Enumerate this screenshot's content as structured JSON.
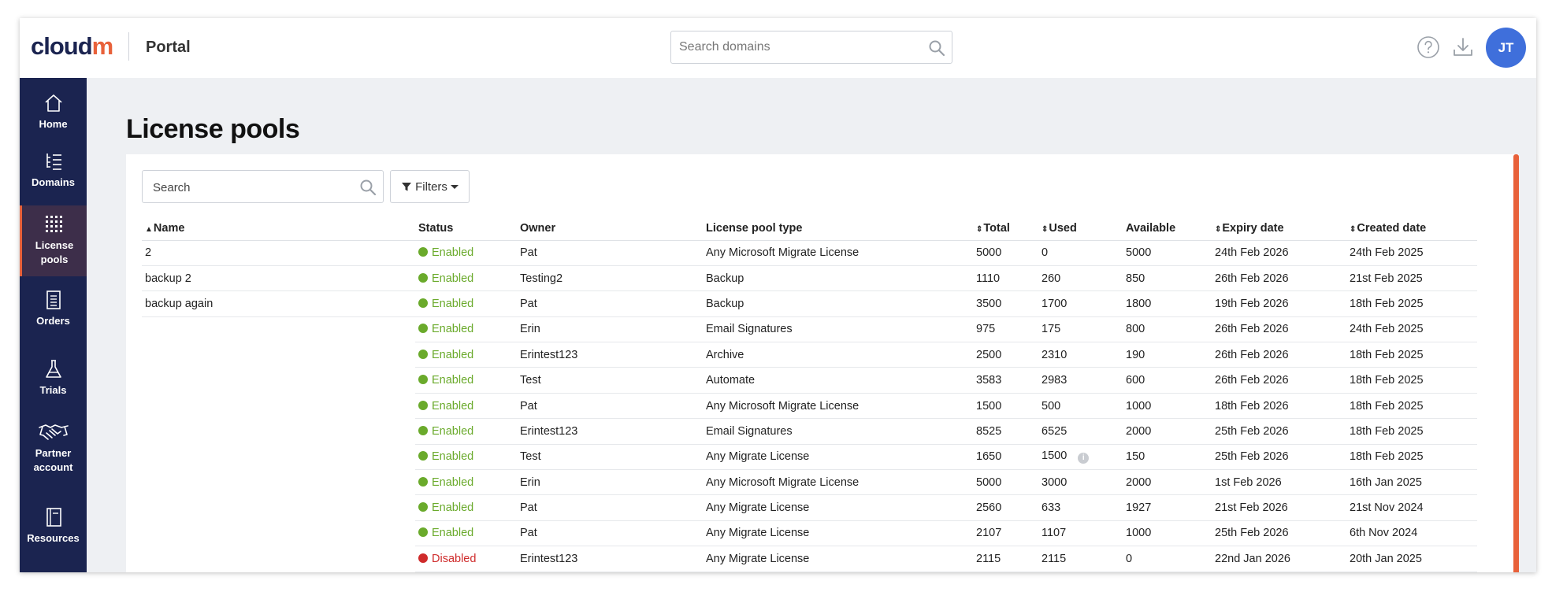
{
  "header": {
    "logo_text_main": "cloud",
    "logo_text_accent": "m",
    "app_name": "Portal",
    "search_placeholder": "Search domains",
    "avatar_initials": "JT"
  },
  "sidebar": {
    "items": [
      {
        "label": "Home",
        "icon": "home-icon"
      },
      {
        "label": "Domains",
        "icon": "domains-icon"
      },
      {
        "label": "License pools",
        "icon": "grid-icon",
        "active": true
      },
      {
        "label": "Orders",
        "icon": "receipt-icon"
      },
      {
        "label": "Trials",
        "icon": "flask-icon"
      },
      {
        "label": "Partner account",
        "icon": "handshake-icon"
      },
      {
        "label": "Resources",
        "icon": "book-icon"
      }
    ]
  },
  "page": {
    "title": "License pools",
    "search_placeholder": "Search",
    "filters_label": "Filters"
  },
  "colors": {
    "navy": "#1b2450",
    "accent": "#e8613a",
    "enabled": "#6aaa2b",
    "disabled": "#cf2b2b",
    "avatar": "#3f6fdb"
  },
  "table": {
    "columns": [
      "Name",
      "Status",
      "Owner",
      "License pool type",
      "Total",
      "Used",
      "Available",
      "Expiry date",
      "Created date"
    ],
    "rows": [
      {
        "name": "2",
        "status": "Enabled",
        "owner": "Pat",
        "type": "Any Microsoft Migrate License",
        "total": "5000",
        "used": "0",
        "available": "5000",
        "expiry": "24th Feb 2026",
        "created": "24th Feb 2025"
      },
      {
        "name": "backup 2",
        "status": "Enabled",
        "owner": "Testing2",
        "type": "Backup",
        "total": "1110",
        "used": "260",
        "available": "850",
        "expiry": "26th Feb 2026",
        "created": "21st Feb 2025"
      },
      {
        "name": "backup again",
        "status": "Enabled",
        "owner": "Pat",
        "type": "Backup",
        "total": "3500",
        "used": "1700",
        "available": "1800",
        "expiry": "19th Feb 2026",
        "created": "18th Feb 2025"
      },
      {
        "name": "",
        "status": "Enabled",
        "owner": "Erin",
        "type": "Email Signatures",
        "total": "975",
        "used": "175",
        "available": "800",
        "expiry": "26th Feb 2026",
        "created": "24th Feb 2025"
      },
      {
        "name": "",
        "status": "Enabled",
        "owner": "Erintest123",
        "type": "Archive",
        "total": "2500",
        "used": "2310",
        "available": "190",
        "expiry": "26th Feb 2026",
        "created": "18th Feb 2025"
      },
      {
        "name": "",
        "status": "Enabled",
        "owner": "Test",
        "type": "Automate",
        "total": "3583",
        "used": "2983",
        "available": "600",
        "expiry": "26th Feb 2026",
        "created": "18th Feb 2025"
      },
      {
        "name": "",
        "status": "Enabled",
        "owner": "Pat",
        "type": "Any Microsoft Migrate License",
        "total": "1500",
        "used": "500",
        "available": "1000",
        "expiry": "18th Feb 2026",
        "created": "18th Feb 2025"
      },
      {
        "name": "",
        "status": "Enabled",
        "owner": "Erintest123",
        "type": "Email Signatures",
        "total": "8525",
        "used": "6525",
        "available": "2000",
        "expiry": "25th Feb 2026",
        "created": "18th Feb 2025"
      },
      {
        "name": "",
        "status": "Enabled",
        "owner": "Test",
        "type": "Any Migrate License",
        "total": "1650",
        "used": "1500",
        "used_info": true,
        "available": "150",
        "expiry": "25th Feb 2026",
        "created": "18th Feb 2025"
      },
      {
        "name": "",
        "status": "Enabled",
        "owner": "Erin",
        "type": "Any Microsoft Migrate License",
        "total": "5000",
        "used": "3000",
        "available": "2000",
        "expiry": "1st Feb 2026",
        "created": "16th Jan 2025"
      },
      {
        "name": "",
        "status": "Enabled",
        "owner": "Pat",
        "type": "Any Migrate License",
        "total": "2560",
        "used": "633",
        "available": "1927",
        "expiry": "21st Feb 2026",
        "created": "21st Nov 2024"
      },
      {
        "name": "",
        "status": "Enabled",
        "owner": "Pat",
        "type": "Any Migrate License",
        "total": "2107",
        "used": "1107",
        "available": "1000",
        "expiry": "25th Feb 2026",
        "created": "6th Nov 2024"
      },
      {
        "name": "",
        "status": "Disabled",
        "owner": "Erintest123",
        "type": "Any Migrate License",
        "total": "2115",
        "used": "2115",
        "available": "0",
        "expiry": "22nd Jan 2026",
        "created": "20th Jan 2025"
      }
    ]
  }
}
